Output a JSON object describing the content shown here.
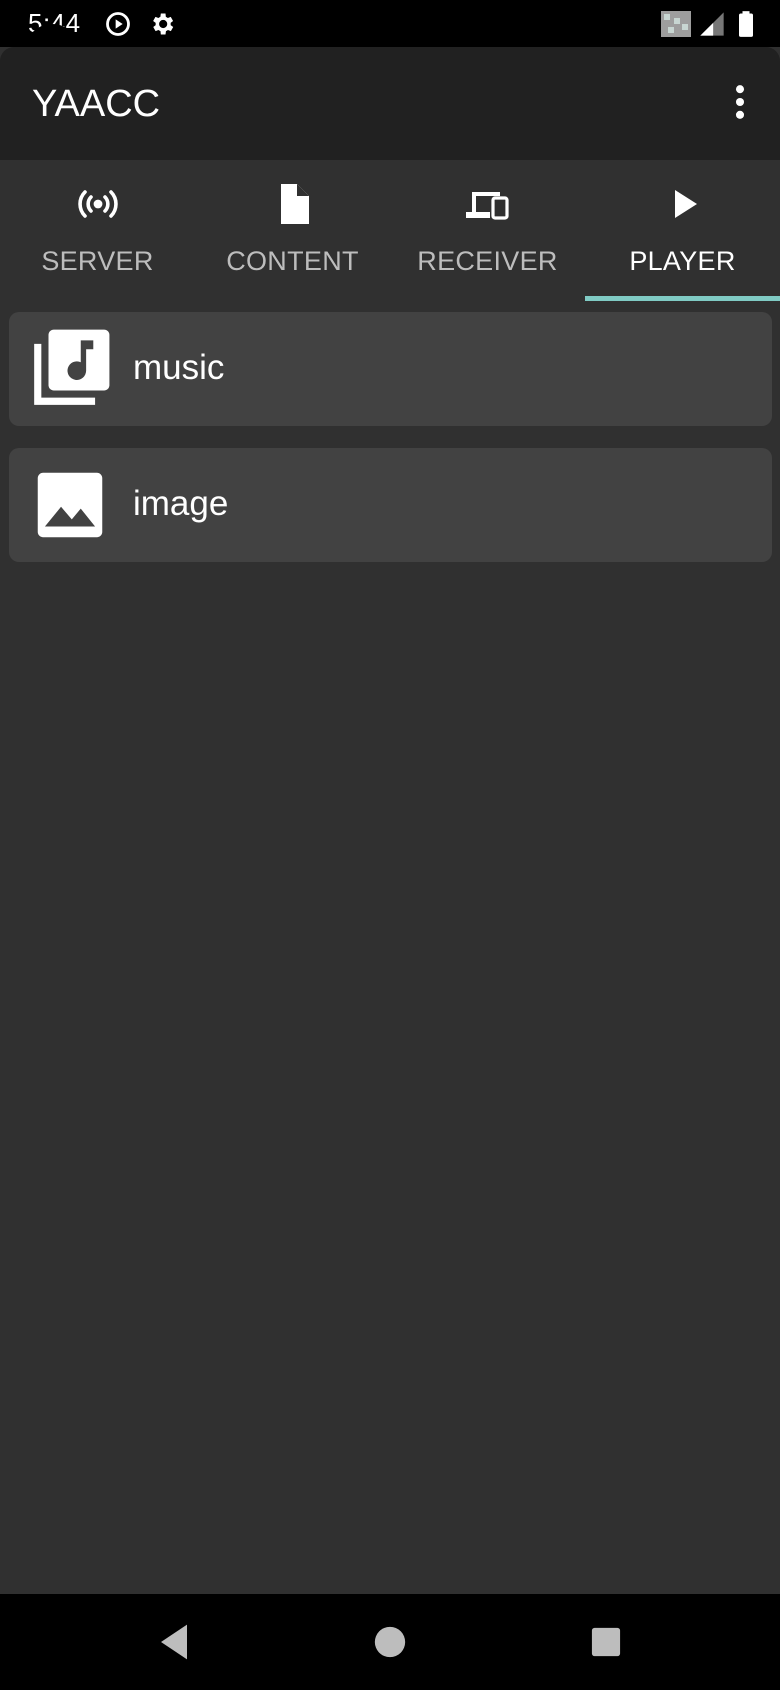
{
  "status_bar": {
    "time": "5:44",
    "icons": [
      "play-circle-icon",
      "gear-icon",
      "wifi-signal-icon",
      "cell-signal-icon",
      "battery-icon"
    ]
  },
  "app_bar": {
    "title": "YAACC",
    "overflow_icon": "more-vert-icon"
  },
  "tabs": [
    {
      "label": "SERVER",
      "icon": "broadcast-icon",
      "active": false
    },
    {
      "label": "CONTENT",
      "icon": "file-icon",
      "active": false
    },
    {
      "label": "RECEIVER",
      "icon": "devices-icon",
      "active": false
    },
    {
      "label": "PLAYER",
      "icon": "play-icon",
      "active": true
    }
  ],
  "list": {
    "items": [
      {
        "label": "music",
        "icon": "music-library-icon"
      },
      {
        "label": "image",
        "icon": "image-icon"
      }
    ]
  },
  "nav_bar": {
    "buttons": [
      "back-icon",
      "home-icon",
      "recents-icon"
    ]
  },
  "colors": {
    "background": "#303030",
    "app_bar": "#212121",
    "list_item": "#424242",
    "accent": "#80cbc4",
    "inactive_tab_text": "#bdbdbd"
  }
}
